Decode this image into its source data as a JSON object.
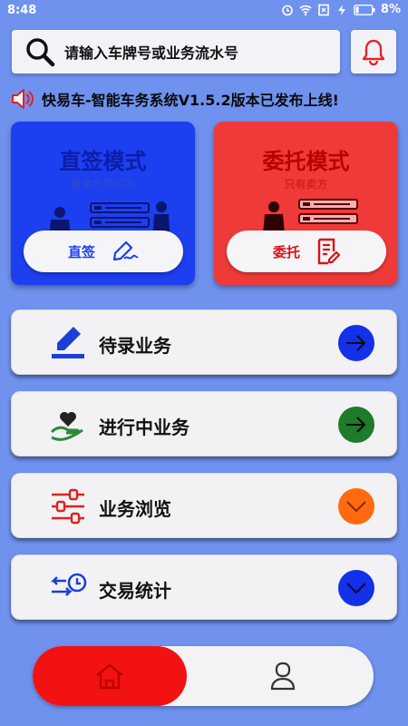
{
  "status_bar": {
    "time": "8:48",
    "battery": "8%"
  },
  "search": {
    "placeholder": "请输入车牌号或业务流水号",
    "icon": "search-icon"
  },
  "notice": {
    "text": "快易车-智能车务系统V1.5.2版本已发布上线!",
    "icon": "speaker-icon"
  },
  "modes": [
    {
      "title": "直签模式",
      "subtitle": "有卖方和买方",
      "button": "直签",
      "color": "#1c3ff0"
    },
    {
      "title": "委托模式",
      "subtitle": "只有卖方",
      "button": "委托",
      "color": "#f03a3a"
    }
  ],
  "menu": [
    {
      "label": "待录业务",
      "icon": "pen-icon",
      "arrow_color": "#1231e8",
      "arrow_icon": "arrow-right-icon"
    },
    {
      "label": "进行中业务",
      "icon": "heart-hand-icon",
      "arrow_color": "#1f7a2a",
      "arrow_icon": "arrow-right-icon"
    },
    {
      "label": "业务浏览",
      "icon": "sliders-icon",
      "arrow_color": "#ff6a10",
      "arrow_icon": "chevron-down-icon"
    },
    {
      "label": "交易统计",
      "icon": "exchange-clock-icon",
      "arrow_color": "#1231e8",
      "arrow_icon": "chevron-down-icon"
    }
  ],
  "bottom_nav": {
    "items": [
      {
        "name": "home",
        "icon": "home-icon",
        "active": true
      },
      {
        "name": "mine",
        "icon": "user-icon",
        "active": false
      }
    ]
  }
}
